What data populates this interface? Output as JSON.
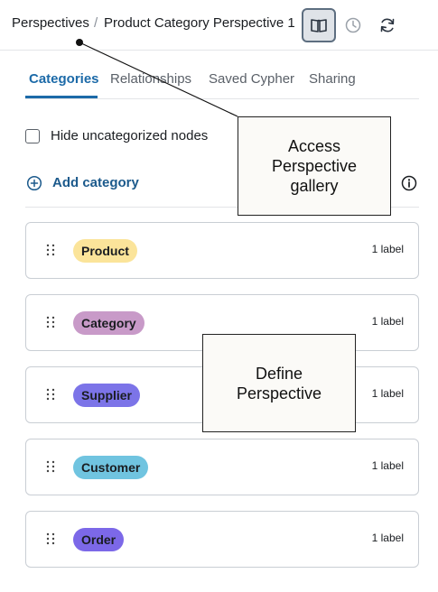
{
  "header": {
    "breadcrumb_root": "Perspectives",
    "breadcrumb_sep": "/",
    "breadcrumb_current": "Product Category Perspective 1",
    "buttons": [
      {
        "icon": "book-open-icon"
      },
      {
        "icon": "clock-icon"
      },
      {
        "icon": "refresh-icon"
      }
    ]
  },
  "tabs": [
    {
      "label": "Categories",
      "active": true
    },
    {
      "label": "Relationships",
      "active": false
    },
    {
      "label": "Saved Cypher",
      "active": false
    },
    {
      "label": "Sharing",
      "active": false
    }
  ],
  "options": {
    "hide_uncategorized_label": "Hide uncategorized nodes",
    "hide_uncategorized_checked": false
  },
  "actions": {
    "add_category_label": "Add category"
  },
  "categories": [
    {
      "name": "Product",
      "count": "1 label",
      "color": "#fbe49a"
    },
    {
      "name": "Category",
      "count": "1 label",
      "color": "#c89ac8"
    },
    {
      "name": "Supplier",
      "count": "1 label",
      "color": "#7c74e8"
    },
    {
      "name": "Customer",
      "count": "1 label",
      "color": "#70c4e0"
    },
    {
      "name": "Order",
      "count": "1 label",
      "color": "#7c68e8"
    }
  ],
  "callouts": {
    "gallery": "Access\nPerspective\ngallery",
    "define": "Define\nPerspective"
  },
  "colors": {
    "accent": "#1c6aa8",
    "link": "#1c5a8c"
  }
}
